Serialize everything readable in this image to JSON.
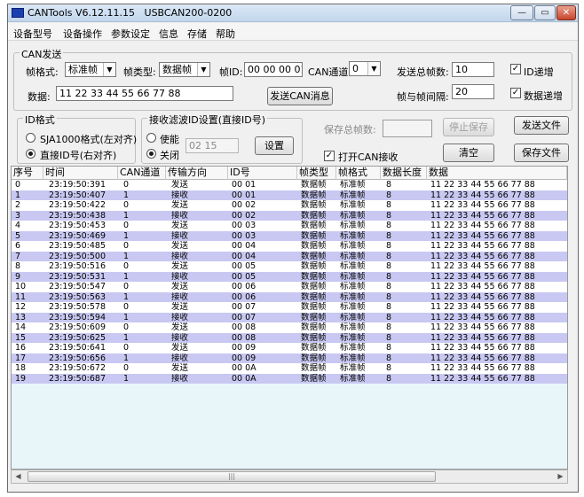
{
  "window": {
    "title": "CANTools V6.12.11.15   USBCAN200-0200"
  },
  "title_buttons": {
    "min": "—",
    "max": "▭",
    "close": "✕"
  },
  "menu": [
    "设备型号",
    "设备操作",
    "参数设定",
    "信息",
    "存储",
    "帮助"
  ],
  "can_send": {
    "legend": "CAN发送",
    "frame_format_label": "帧格式:",
    "frame_format_value": "标准帧",
    "frame_type_label": "帧类型:",
    "frame_type_value": "数据帧",
    "frame_id_label": "帧ID:",
    "frame_id_value": "00 00 00 01",
    "channel_label": "CAN通道:",
    "channel_value": "0",
    "total_frames_label": "发送总帧数:",
    "total_frames_value": "10",
    "id_increment_label": "ID递增",
    "id_increment_checked": true,
    "data_label": "数据:",
    "data_value": "11 22 33 44 55 66 77 88",
    "send_button": "发送CAN消息",
    "frame_interval_label": "帧与帧间隔:",
    "frame_interval_value": "20",
    "data_increment_label": "数据递增",
    "data_increment_checked": true
  },
  "id_format": {
    "legend": "ID格式",
    "option1": "SJA1000格式(左对齐)",
    "option2": "直接ID号(右对齐)",
    "selected": 2
  },
  "filter": {
    "legend": "接收滤波ID设置(直接ID号)",
    "enable_label": "使能",
    "close_label": "关闭",
    "selected": "关闭",
    "id_value": "02 15",
    "set_button": "设置"
  },
  "save": {
    "total_frames_label": "保存总帧数:",
    "stop_save_button": "停止保存",
    "clear_button": "清空",
    "send_file_button": "发送文件",
    "save_file_button": "保存文件",
    "open_can_recv_label": "打开CAN接收",
    "open_can_recv_checked": true
  },
  "table": {
    "columns": [
      "序号",
      "时间",
      "CAN通道",
      "传输方向",
      "ID号",
      "帧类型",
      "帧格式",
      "数据长度",
      "数据"
    ],
    "rows": [
      [
        "0",
        "23:19:50:391",
        "0",
        "发送",
        "00 01",
        "数据帧",
        "标准帧",
        "8",
        "11 22 33 44 55 66 77 88"
      ],
      [
        "1",
        "23:19:50:407",
        "1",
        "接收",
        "00 01",
        "数据帧",
        "标准帧",
        "8",
        "11 22 33 44 55 66 77 88"
      ],
      [
        "2",
        "23:19:50:422",
        "0",
        "发送",
        "00 02",
        "数据帧",
        "标准帧",
        "8",
        "11 22 33 44 55 66 77 88"
      ],
      [
        "3",
        "23:19:50:438",
        "1",
        "接收",
        "00 02",
        "数据帧",
        "标准帧",
        "8",
        "11 22 33 44 55 66 77 88"
      ],
      [
        "4",
        "23:19:50:453",
        "0",
        "发送",
        "00 03",
        "数据帧",
        "标准帧",
        "8",
        "11 22 33 44 55 66 77 88"
      ],
      [
        "5",
        "23:19:50:469",
        "1",
        "接收",
        "00 03",
        "数据帧",
        "标准帧",
        "8",
        "11 22 33 44 55 66 77 88"
      ],
      [
        "6",
        "23:19:50:485",
        "0",
        "发送",
        "00 04",
        "数据帧",
        "标准帧",
        "8",
        "11 22 33 44 55 66 77 88"
      ],
      [
        "7",
        "23:19:50:500",
        "1",
        "接收",
        "00 04",
        "数据帧",
        "标准帧",
        "8",
        "11 22 33 44 55 66 77 88"
      ],
      [
        "8",
        "23:19:50:516",
        "0",
        "发送",
        "00 05",
        "数据帧",
        "标准帧",
        "8",
        "11 22 33 44 55 66 77 88"
      ],
      [
        "9",
        "23:19:50:531",
        "1",
        "接收",
        "00 05",
        "数据帧",
        "标准帧",
        "8",
        "11 22 33 44 55 66 77 88"
      ],
      [
        "10",
        "23:19:50:547",
        "0",
        "发送",
        "00 06",
        "数据帧",
        "标准帧",
        "8",
        "11 22 33 44 55 66 77 88"
      ],
      [
        "11",
        "23:19:50:563",
        "1",
        "接收",
        "00 06",
        "数据帧",
        "标准帧",
        "8",
        "11 22 33 44 55 66 77 88"
      ],
      [
        "12",
        "23:19:50:578",
        "0",
        "发送",
        "00 07",
        "数据帧",
        "标准帧",
        "8",
        "11 22 33 44 55 66 77 88"
      ],
      [
        "13",
        "23:19:50:594",
        "1",
        "接收",
        "00 07",
        "数据帧",
        "标准帧",
        "8",
        "11 22 33 44 55 66 77 88"
      ],
      [
        "14",
        "23:19:50:609",
        "0",
        "发送",
        "00 08",
        "数据帧",
        "标准帧",
        "8",
        "11 22 33 44 55 66 77 88"
      ],
      [
        "15",
        "23:19:50:625",
        "1",
        "接收",
        "00 08",
        "数据帧",
        "标准帧",
        "8",
        "11 22 33 44 55 66 77 88"
      ],
      [
        "16",
        "23:19:50:641",
        "0",
        "发送",
        "00 09",
        "数据帧",
        "标准帧",
        "8",
        "11 22 33 44 55 66 77 88"
      ],
      [
        "17",
        "23:19:50:656",
        "1",
        "接收",
        "00 09",
        "数据帧",
        "标准帧",
        "8",
        "11 22 33 44 55 66 77 88"
      ],
      [
        "18",
        "23:19:50:672",
        "0",
        "发送",
        "00 0A",
        "数据帧",
        "标准帧",
        "8",
        "11 22 33 44 55 66 77 88"
      ],
      [
        "19",
        "23:19:50:687",
        "1",
        "接收",
        "00 0A",
        "数据帧",
        "标准帧",
        "8",
        "11 22 33 44 55 66 77 88"
      ]
    ]
  },
  "scrollbar": {
    "left": "◀",
    "right": "▶",
    "thumb": "|||"
  }
}
